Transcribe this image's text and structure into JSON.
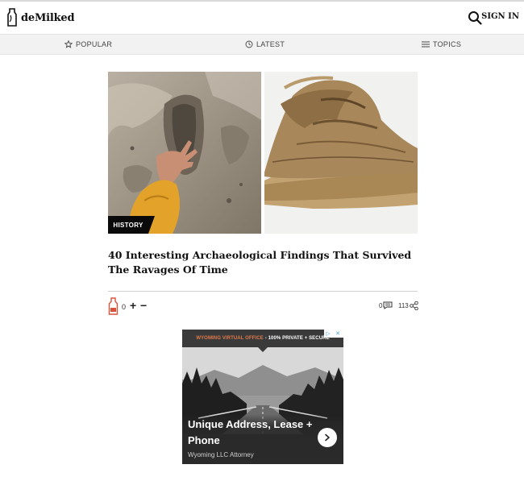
{
  "header": {
    "logo_text": "deMilked",
    "signin_label": "SIGN IN"
  },
  "nav": {
    "popular": "POPULAR",
    "latest": "LATEST",
    "topics": "TOPICS"
  },
  "article": {
    "tag": "HISTORY",
    "title": "40 Interesting Archaeological Findings That Survived The Ravages Of Time",
    "vote_count": "0",
    "plus": "+",
    "minus": "−",
    "comments_count": "0",
    "shares_count": "113"
  },
  "ad": {
    "banner_accent": "WYOMING VIRTUAL OFFICE",
    "banner_text": "- 100% PRIVATE + SECURE",
    "headline": "Unique Address, Lease + Phone",
    "sub": "Wyoming LLC Attorney"
  },
  "colors": {
    "brand_accent": "#d9533a",
    "nav_bg": "#f2f2f2",
    "tag_bg": "#0a0a0a"
  }
}
